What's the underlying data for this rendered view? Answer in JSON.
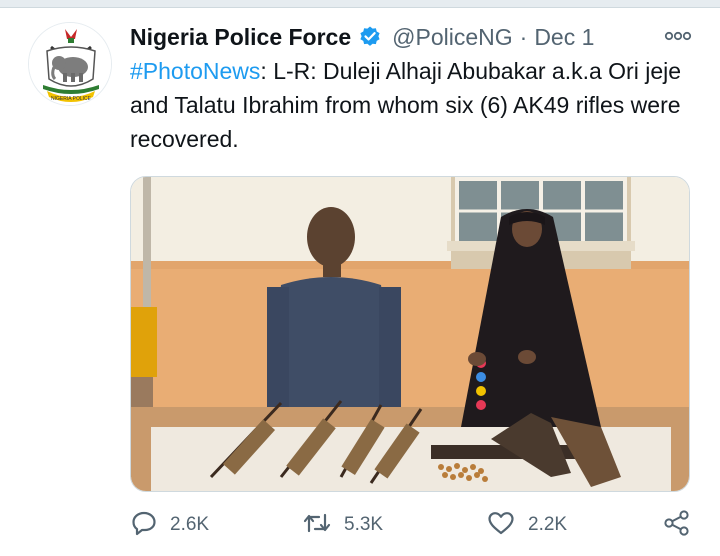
{
  "tweet": {
    "author_name": "Nigeria Police Force",
    "handle": "@PoliceNG",
    "separator": "·",
    "date": "Dec 1",
    "hashtag": "#PhotoNews",
    "body": ": L-R: Duleji Alhaji Abubakar a.k.a Ori jeje and Talatu Ibrahim from whom six (6) AK49 rifles were recovered.",
    "avatar_caption": "NIGERIA POLICE"
  },
  "actions": {
    "reply_count": "2.6K",
    "retweet_count": "5.3K",
    "like_count": "2.2K"
  },
  "icons": {
    "verified": "verified-badge-icon",
    "more": "more-options-icon",
    "reply": "reply-icon",
    "retweet": "retweet-icon",
    "like": "heart-icon",
    "share": "share-icon"
  },
  "colors": {
    "accent": "#1d9bf0",
    "text_primary": "#0f1419",
    "text_secondary": "#536471"
  }
}
